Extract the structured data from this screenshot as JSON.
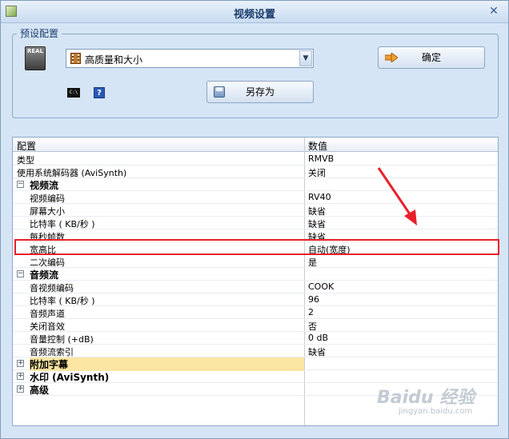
{
  "window": {
    "title": "视频设置"
  },
  "preset": {
    "legend": "预设配置",
    "selected": "高质量和大小",
    "ok_label": "确定",
    "saveas_label": "另存为",
    "real_badge": "REAL",
    "cmd_label": "C:\\"
  },
  "grid": {
    "col_name": "配置",
    "col_value": "数值",
    "rows": [
      {
        "name": "类型",
        "value": "RMVB"
      },
      {
        "name": "使用系统解码器 (AviSynth)",
        "value": "关闭"
      },
      {
        "name": "视频流",
        "value": "",
        "expander": "−"
      },
      {
        "name": "视频编码",
        "value": "RV40"
      },
      {
        "name": "屏幕大小",
        "value": "缺省"
      },
      {
        "name": "比特率 ( KB/秒 )",
        "value": "缺省"
      },
      {
        "name": "每秒帧数",
        "value": "缺省"
      },
      {
        "name": "宽高比",
        "value": "自动(宽度)"
      },
      {
        "name": "二次编码",
        "value": "是"
      },
      {
        "name": "音频流",
        "value": "",
        "expander": "−"
      },
      {
        "name": "音视频编码",
        "value": "COOK"
      },
      {
        "name": "比特率 ( KB/秒 )",
        "value": "96"
      },
      {
        "name": "音频声道",
        "value": "2"
      },
      {
        "name": "关闭音效",
        "value": "否"
      },
      {
        "name": "音量控制 (+dB)",
        "value": "0 dB"
      },
      {
        "name": "音频流索引",
        "value": "缺省"
      },
      {
        "name": "附加字幕",
        "value": "",
        "expander": "+"
      },
      {
        "name": "水印 (AviSynth)",
        "value": "",
        "expander": "+"
      },
      {
        "name": "高级",
        "value": "",
        "expander": "+"
      }
    ]
  },
  "watermark": {
    "text": "Baidu 经验",
    "sub": "jingyan.baidu.com"
  },
  "colors": {
    "highlight_border": "#e8202a",
    "window_bg": "#d6e5f5"
  }
}
